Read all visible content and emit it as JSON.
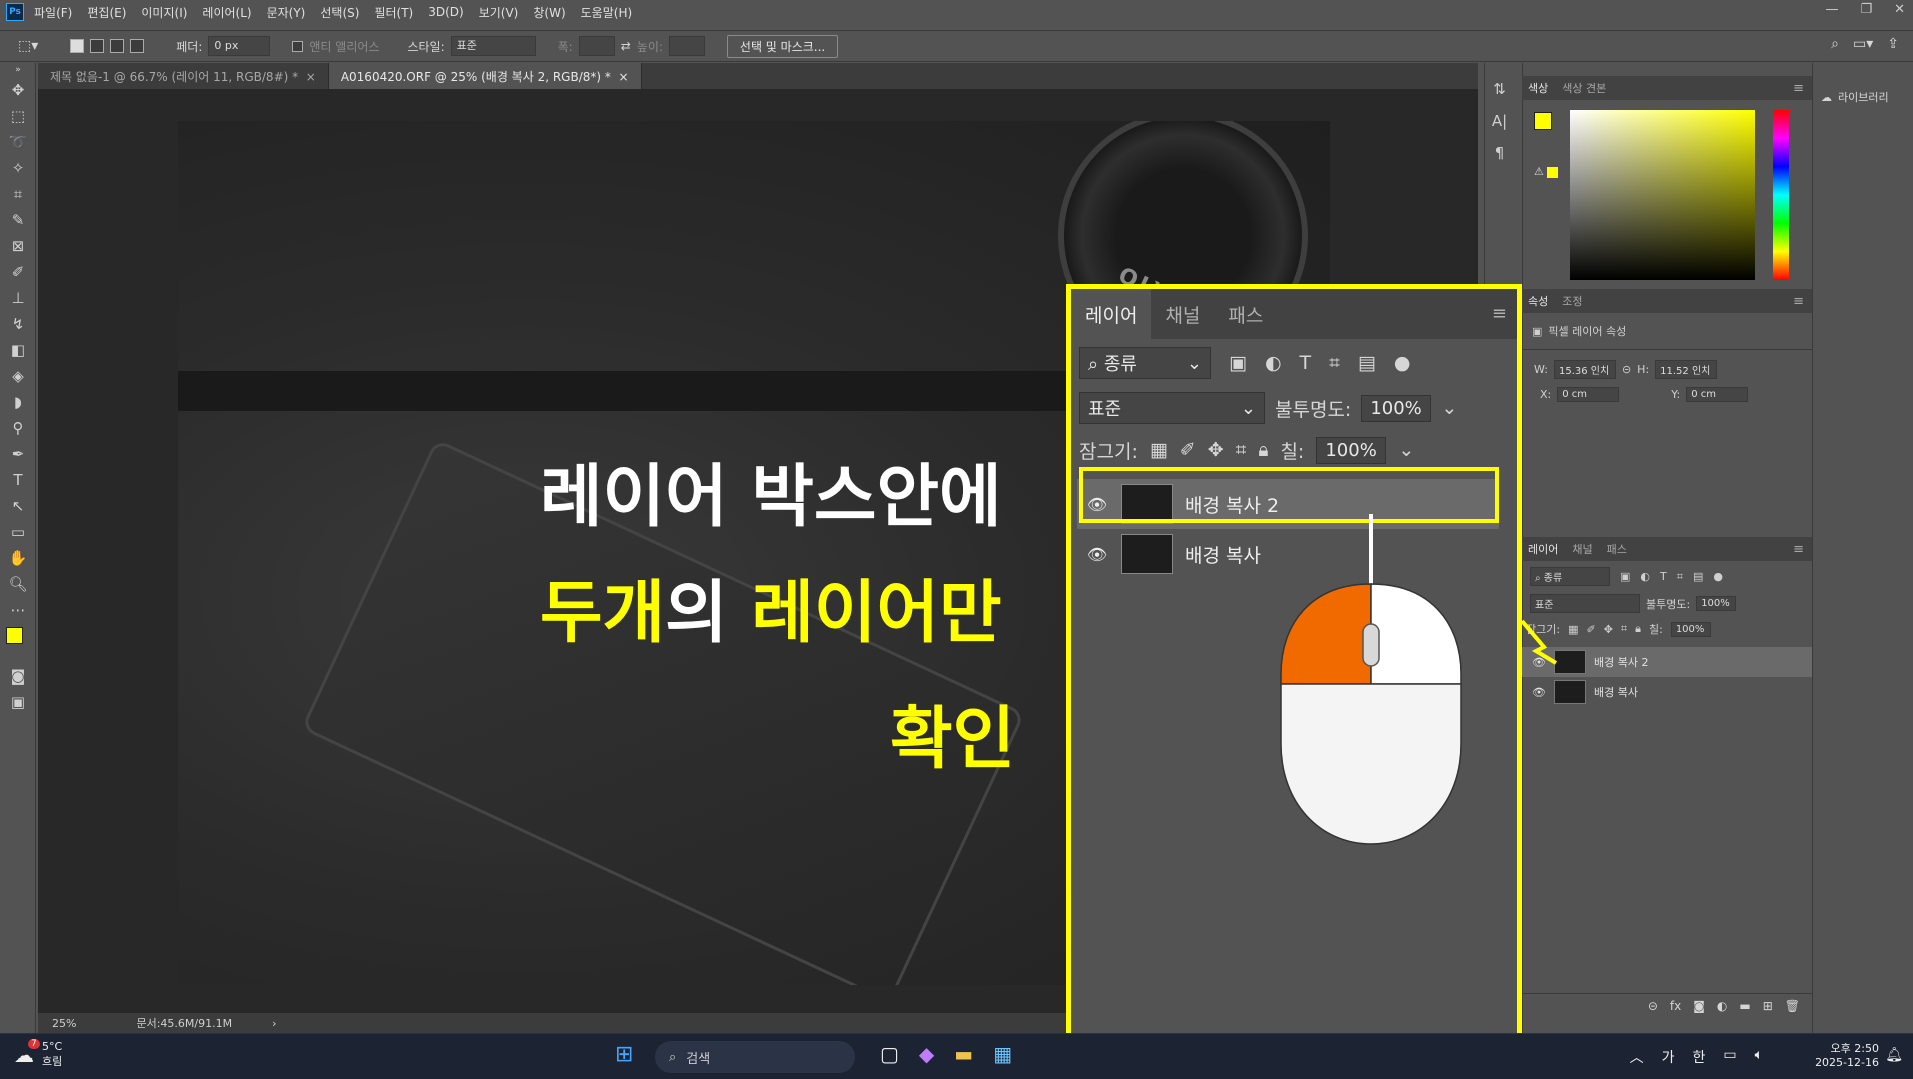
{
  "app": {
    "logo": "Ps"
  },
  "menu": [
    "파일(F)",
    "편집(E)",
    "이미지(I)",
    "레이어(L)",
    "문자(Y)",
    "선택(S)",
    "필터(T)",
    "3D(D)",
    "보기(V)",
    "창(W)",
    "도움말(H)"
  ],
  "window_controls": [
    "—",
    "❐",
    "✕"
  ],
  "options": {
    "feather_label": "페더:",
    "feather_value": "0 px",
    "antialias_label": "앤티 앨리어스",
    "style_label": "스타일:",
    "style_value": "표준",
    "width_label": "폭:",
    "height_label": "높이:",
    "select_mask_btn": "선택 및 마스크..."
  },
  "doc_tabs": [
    {
      "label": "제목 없음-1 @ 66.7% (레이어 11, RGB/8#) *",
      "close": "×"
    },
    {
      "label": "A0160420.ORF @ 25% (배경 복사 2, RGB/8*) *",
      "close": "×"
    }
  ],
  "overlay": {
    "line1": "레이어 박스안에",
    "line2_a": "두개",
    "line2_b": "의 ",
    "line2_c": "레이어만",
    "line3": "확인",
    "lens_text": "OLYMPUS"
  },
  "status": {
    "zoom": "25%",
    "doc": "문서:45.6M/91.1M",
    "arrow": "›"
  },
  "color_panel": {
    "tabs": [
      "색상",
      "색상 견본"
    ],
    "colors": {
      "foreground": "#ffff00",
      "background": "#ffffff"
    }
  },
  "properties_panel": {
    "tabs": [
      "속성",
      "조정"
    ],
    "title": "픽셀 레이어 속성",
    "w_label": "W:",
    "w_value": "15.36 인치",
    "h_label": "H:",
    "h_value": "11.52 인치",
    "x_label": "X:",
    "x_value": "0 cm",
    "y_label": "Y:",
    "y_value": "0 cm"
  },
  "mini_layers": {
    "tabs": [
      "레이어",
      "채널",
      "패스"
    ],
    "filter": "종류",
    "blend": "표준",
    "opacity_label": "불투명도:",
    "opacity": "100%",
    "lock_label": "잠그기:",
    "fill_label": "칠:",
    "fill": "100%",
    "layers": [
      "배경 복사 2",
      "배경 복사"
    ]
  },
  "big_panel": {
    "tabs": [
      "레이어",
      "채널",
      "패스"
    ],
    "filter": "종류",
    "blend": "표준",
    "opacity_label": "불투명도:",
    "opacity": "100%",
    "lock_label": "잠그기:",
    "fill_label": "칠:",
    "fill": "100%",
    "layers": [
      "배경 복사 2",
      "배경 복사"
    ]
  },
  "library": {
    "label": "라이브러리"
  },
  "taskbar": {
    "weather_temp": "5°C",
    "weather_desc": "흐림",
    "weather_badge": "7",
    "search": "검색",
    "ime1": "가",
    "ime2": "한",
    "time": "오후 2:50",
    "date": "2025-12-16"
  }
}
